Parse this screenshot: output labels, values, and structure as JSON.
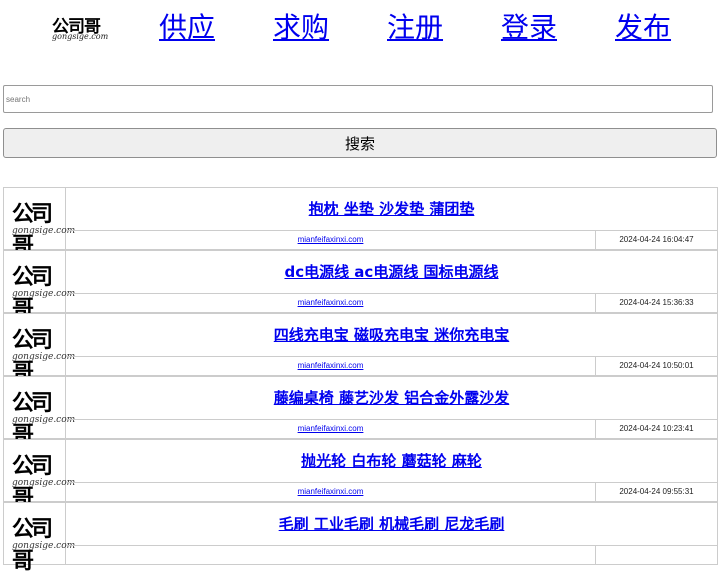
{
  "header": {
    "logo_main": "公司哥",
    "logo_sub": "gongsige.com",
    "nav": [
      "供应",
      "求购",
      "注册",
      "登录",
      "发布"
    ]
  },
  "search": {
    "placeholder": "search",
    "button_label": "搜索"
  },
  "listings": [
    {
      "title": "抱枕 坐垫 沙发垫 蒲团垫",
      "source": "mianfeifaxinxi.com",
      "date": "2024-04-24 16:04:47",
      "thumb_main": "公司哥",
      "thumb_sub": "gongsige.com"
    },
    {
      "title": "dc电源线 ac电源线 国标电源线",
      "source": "mianfeifaxinxi.com",
      "date": "2024-04-24 15:36:33",
      "thumb_main": "公司哥",
      "thumb_sub": "gongsige.com"
    },
    {
      "title": "四线充电宝 磁吸充电宝 迷你充电宝",
      "source": "mianfeifaxinxi.com",
      "date": "2024-04-24 10:50:01",
      "thumb_main": "公司哥",
      "thumb_sub": "gongsige.com"
    },
    {
      "title": "藤编桌椅 藤艺沙发 铝合金外露沙发",
      "source": "mianfeifaxinxi.com",
      "date": "2024-04-24 10:23:41",
      "thumb_main": "公司哥",
      "thumb_sub": "gongsige.com"
    },
    {
      "title": "抛光轮 白布轮 蘑菇轮 麻轮",
      "source": "mianfeifaxinxi.com",
      "date": "2024-04-24 09:55:31",
      "thumb_main": "公司哥",
      "thumb_sub": "gongsige.com"
    },
    {
      "title": "毛刷 工业毛刷 机械毛刷 尼龙毛刷",
      "source": "",
      "date": "",
      "thumb_main": "公司哥",
      "thumb_sub": "gongsige.com"
    }
  ]
}
